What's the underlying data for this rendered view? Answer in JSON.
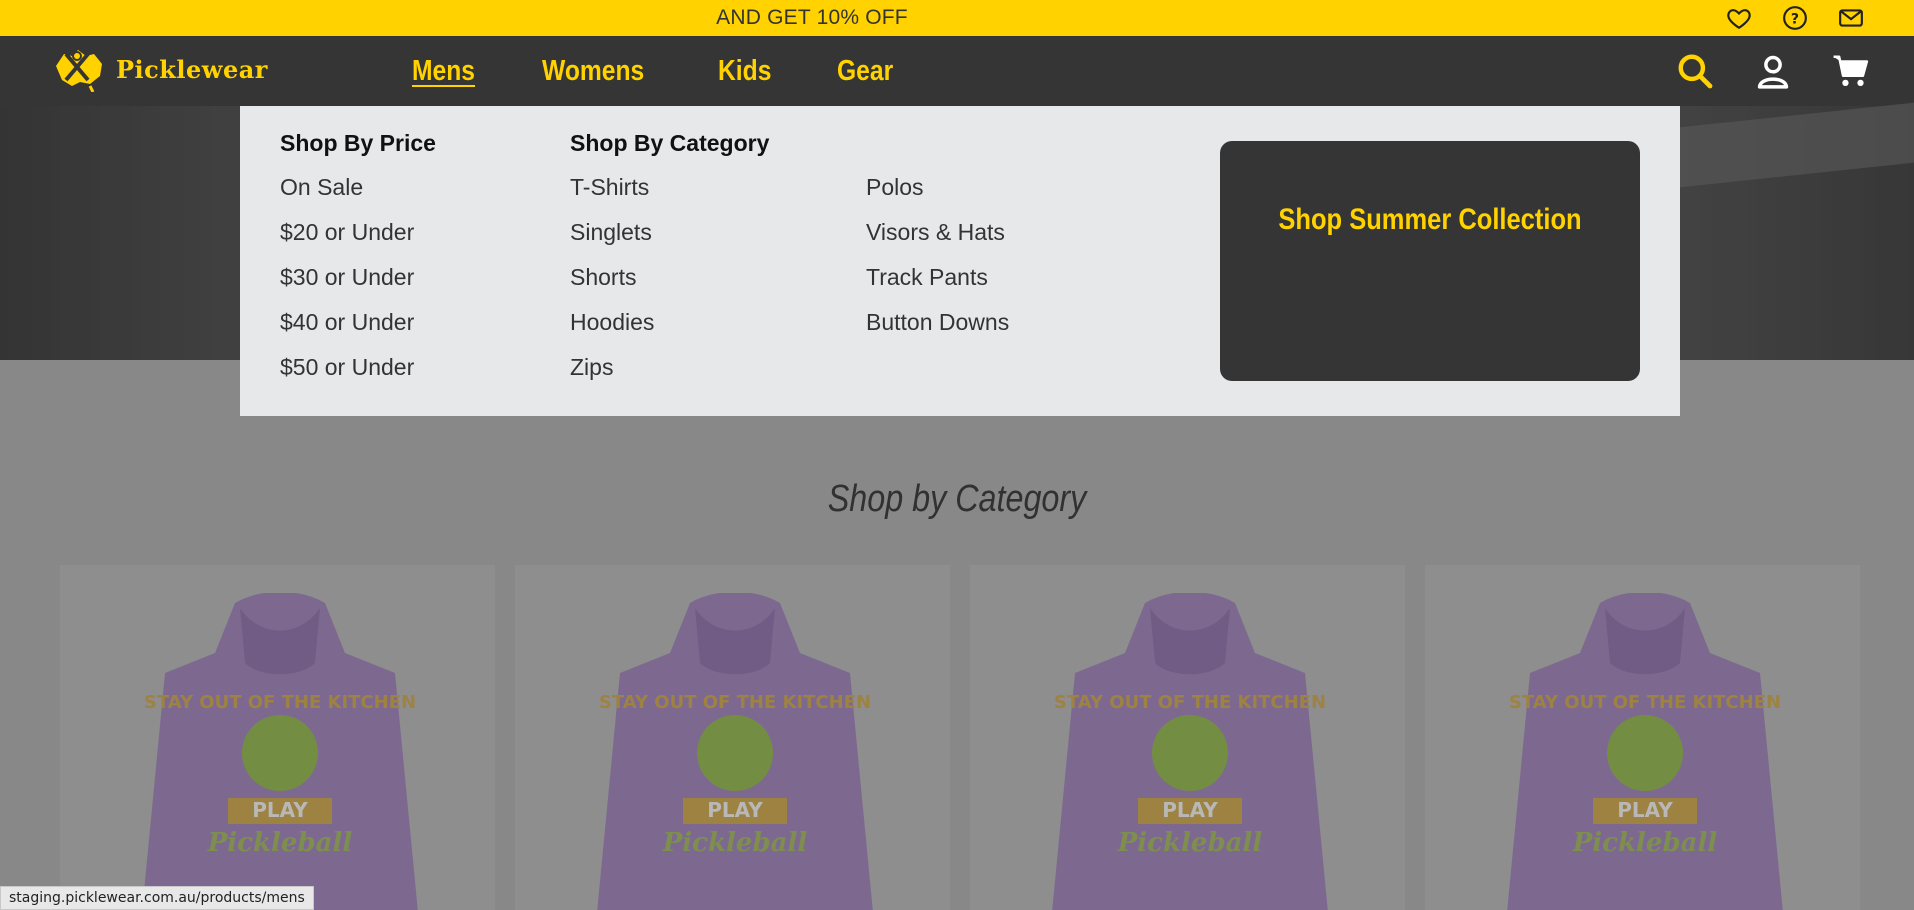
{
  "promo": {
    "text": "AND GET 10% OFF",
    "icons": [
      "heart-icon",
      "help-icon",
      "mail-icon"
    ]
  },
  "header": {
    "brand": "Picklewear",
    "nav": [
      {
        "label": "Mens",
        "active": true
      },
      {
        "label": "Womens",
        "active": false
      },
      {
        "label": "Kids",
        "active": false
      },
      {
        "label": "Gear",
        "active": false
      }
    ],
    "icons": [
      "search-icon",
      "user-icon",
      "cart-icon"
    ]
  },
  "mega_menu": {
    "price": {
      "heading": "Shop By Price",
      "items": [
        "On Sale",
        "$20 or Under",
        "$30 or Under",
        "$40 or Under",
        "$50 or Under"
      ]
    },
    "category": {
      "heading": "Shop By Category",
      "col1": [
        "T-Shirts",
        "Singlets",
        "Shorts",
        "Hoodies",
        "Zips"
      ],
      "col2": [
        "Polos",
        "Visors & Hats",
        "Track Pants",
        "Button Downs"
      ]
    },
    "promo_label": "Shop Summer Collection"
  },
  "main": {
    "section_title": "Shop by Category"
  },
  "status_bar": {
    "url": "staging.picklewear.com.au/products/mens"
  },
  "colors": {
    "accent": "#ffd200",
    "nav_bg": "#353535",
    "menu_bg": "#e7e8ea"
  }
}
